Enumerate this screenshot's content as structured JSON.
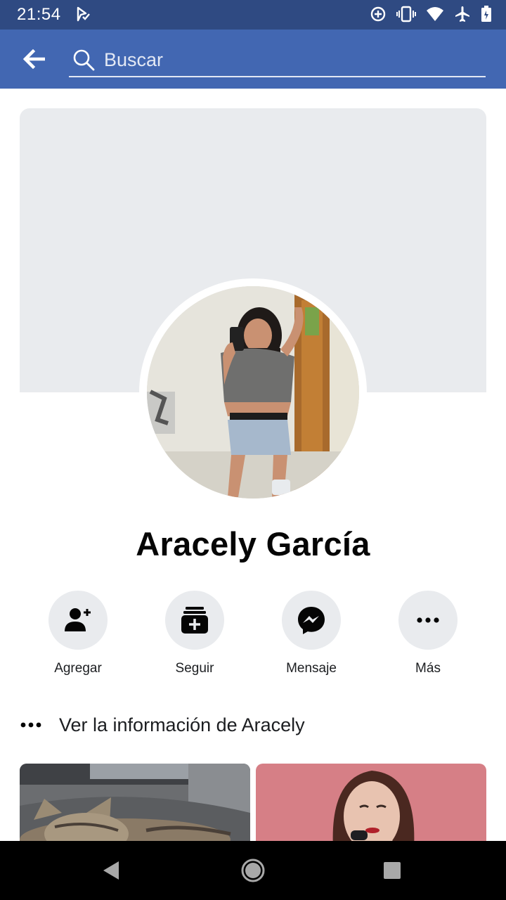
{
  "status_bar": {
    "time": "21:54",
    "icons": [
      "app-notification-icon",
      "data-saver-icon",
      "vibrate-icon",
      "wifi-icon",
      "airplane-mode-icon",
      "battery-icon"
    ]
  },
  "search": {
    "placeholder": "Buscar",
    "value": ""
  },
  "profile": {
    "name": "Aracely García"
  },
  "actions": [
    {
      "label": "Agregar",
      "icon": "add-friend-icon"
    },
    {
      "label": "Seguir",
      "icon": "follow-icon"
    },
    {
      "label": "Mensaje",
      "icon": "messenger-icon"
    },
    {
      "label": "Más",
      "icon": "more-icon"
    }
  ],
  "info": {
    "label": "Ver la información de Aracely",
    "icon": "more-dots-icon"
  },
  "colors": {
    "header": "#4267b2",
    "status_bar": "#2f4a82",
    "cover": "#e9ebee"
  },
  "nav": {
    "icons": [
      "back-triangle-icon",
      "home-circle-icon",
      "recents-square-icon"
    ]
  }
}
